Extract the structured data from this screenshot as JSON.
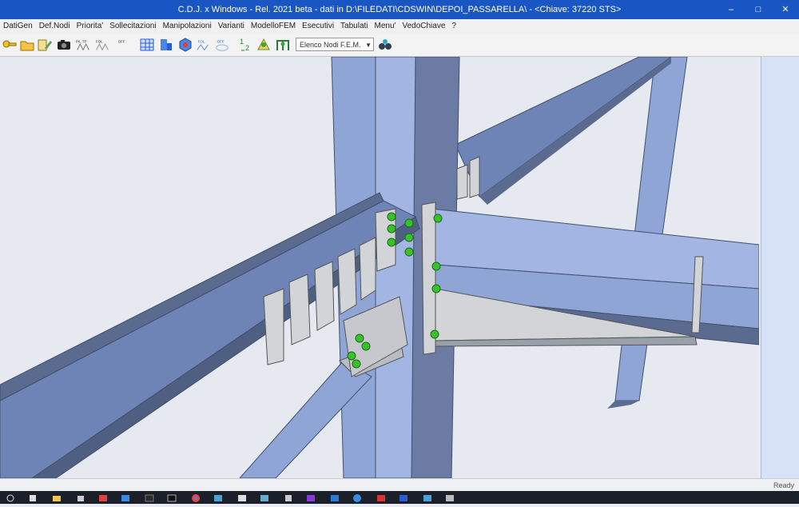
{
  "window": {
    "title": "C.D.J. x Windows - Rel. 2021 beta - dati in D:\\FILEDATI\\CDSWIN\\DEPOI_PASSARELLA\\ - <Chiave: 37220 STS>",
    "minimize": "–",
    "maximize": "□",
    "close": "✕"
  },
  "menu": [
    "DatiGen",
    "Def.Nodi",
    "Priorita'",
    "Sollecitazioni",
    "Manipolazioni",
    "Varianti",
    "ModelloFEM",
    "Esecutivi",
    "Tabulati",
    "Menu'",
    "VedoChiave",
    "?"
  ],
  "toolbar": {
    "icons": [
      "key-icon",
      "folder-open-icon",
      "edit-icon",
      "camera-icon",
      "pil-tp-icon",
      "fol-icon",
      "off-icon",
      "grid-icon",
      "table-icon",
      "cube-icon",
      "fol-view-icon",
      "off-view-icon",
      "numbers-icon",
      "node-icon",
      "frame-icon"
    ],
    "labels": {
      "pil": "PIL TP",
      "fol": "FOL",
      "off": "OFF",
      "fol2": "FOL",
      "off2": "OFF"
    },
    "combo_value": "Elenco Nodi F.E.M.",
    "accent": "#1a55c4"
  },
  "status": {
    "text": "Ready"
  },
  "taskbar": {
    "icons": [
      "start-icon",
      "search-icon",
      "explorer-icon",
      "store-icon",
      "app-icon",
      "app-icon",
      "app-icon",
      "terminal-icon",
      "chrome-icon",
      "app-icon",
      "app-icon",
      "app-icon",
      "app-icon",
      "app-icon",
      "app-icon",
      "app-icon",
      "pdf-icon",
      "app-icon",
      "app-icon",
      "app-icon",
      "app-icon"
    ]
  },
  "colors": {
    "steel": "#8fa5d6",
    "steel_dark": "#5a6b8f",
    "plate": "#d2d4d8",
    "bolt": "#39c12c"
  }
}
